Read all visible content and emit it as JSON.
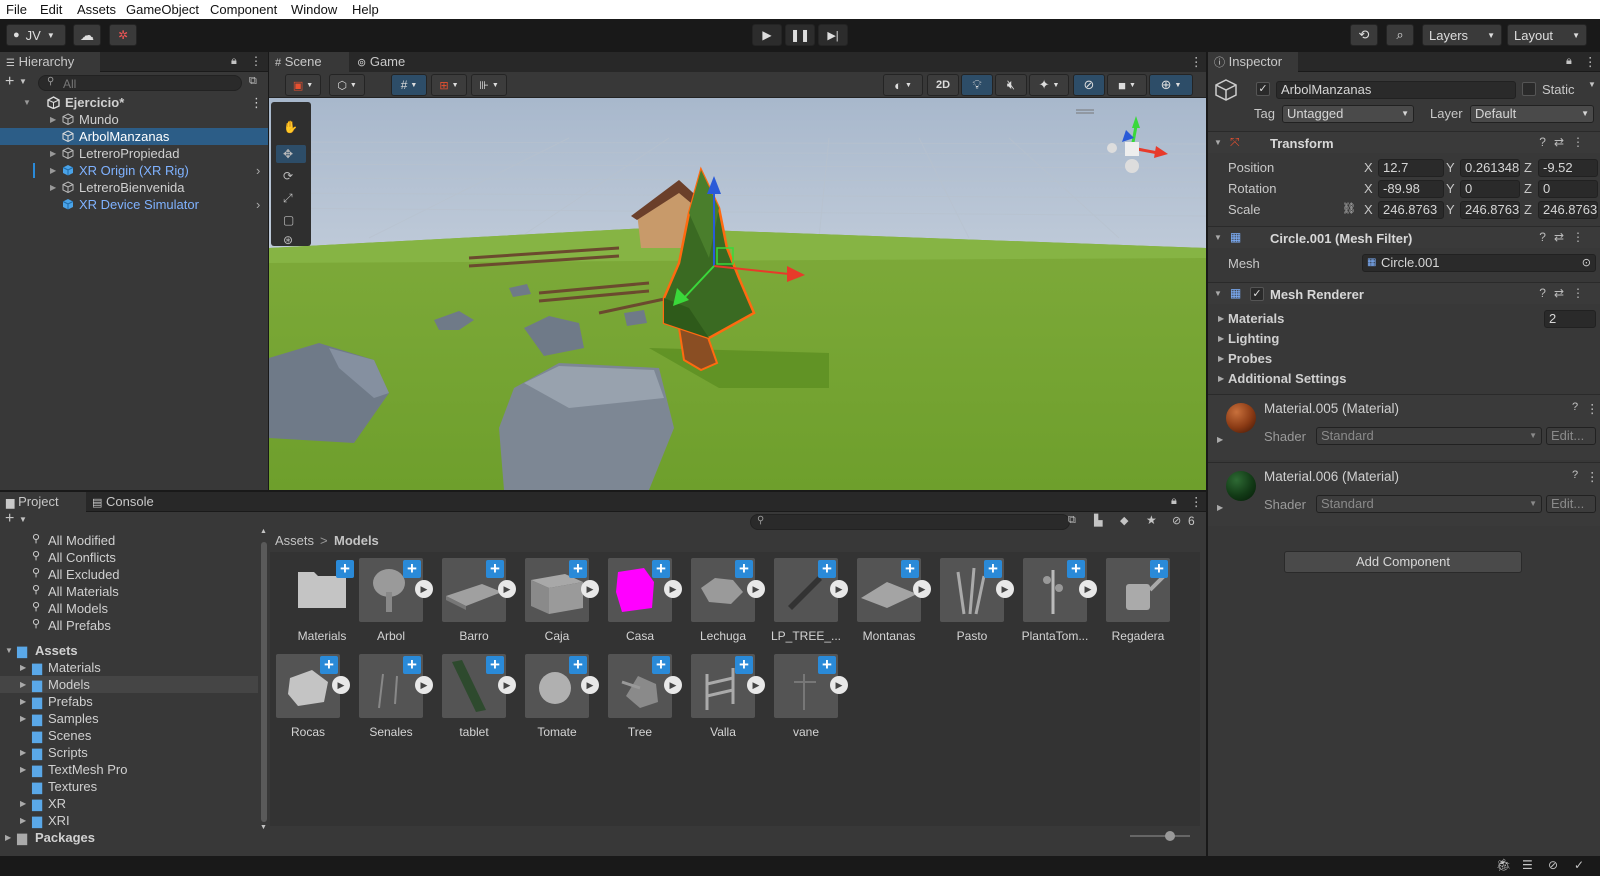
{
  "menubar": {
    "items": [
      "File",
      "Edit",
      "Assets",
      "GameObject",
      "Component",
      "Window",
      "Help"
    ]
  },
  "toolbar": {
    "account": "JV",
    "layers": "Layers",
    "layout": "Layout"
  },
  "hierarchy": {
    "tab": "Hierarchy",
    "search_placeholder": "All",
    "scene": "Ejercicio*",
    "items": [
      "Mundo",
      "ArbolManzanas",
      "LetreroPropiedad",
      "XR Origin (XR Rig)",
      "LetreroBienvenida",
      "XR Device Simulator"
    ]
  },
  "scene_view": {
    "tab_scene": "Scene",
    "tab_game": "Game",
    "mode_2d": "2D"
  },
  "project": {
    "tab_project": "Project",
    "tab_console": "Console",
    "favorites": [
      "All Modified",
      "All Conflicts",
      "All Excluded",
      "All Materials",
      "All Models",
      "All Prefabs"
    ],
    "assets_root": "Assets",
    "folders": [
      "Materials",
      "Models",
      "Prefabs",
      "Samples",
      "Scenes",
      "Scripts",
      "TextMesh Pro",
      "Textures",
      "XR",
      "XRI"
    ],
    "packages": "Packages",
    "breadcrumb_root": "Assets",
    "breadcrumb_sep": ">",
    "breadcrumb_current": "Models",
    "hidden_count": "6",
    "assets_row1": [
      "Materials",
      "Arbol",
      "Barro",
      "Caja",
      "Casa",
      "Lechuga",
      "LP_TREE_...",
      "Montanas",
      "Pasto",
      "PlantaTom...",
      "Regadera"
    ],
    "assets_row2": [
      "Rocas",
      "Senales",
      "tablet",
      "Tomate",
      "Tree",
      "Valla",
      "vane"
    ]
  },
  "inspector": {
    "tab": "Inspector",
    "object_name": "ArbolManzanas",
    "static_label": "Static",
    "tag_label": "Tag",
    "tag_value": "Untagged",
    "layer_label": "Layer",
    "layer_value": "Default",
    "transform": {
      "title": "Transform",
      "position_label": "Position",
      "px": "12.7",
      "py": "0.261348",
      "pz": "-9.52",
      "rotation_label": "Rotation",
      "rx": "-89.98",
      "ry": "0",
      "rz": "0",
      "scale_label": "Scale",
      "sx": "246.8763",
      "sy": "246.8763",
      "sz": "246.8763",
      "x": "X",
      "y": "Y",
      "z": "Z"
    },
    "mesh_filter": {
      "title": "Circle.001 (Mesh Filter)",
      "mesh_label": "Mesh",
      "mesh_value": "Circle.001"
    },
    "mesh_renderer": {
      "title": "Mesh Renderer",
      "materials_label": "Materials",
      "materials_count": "2",
      "lighting": "Lighting",
      "probes": "Probes",
      "additional": "Additional Settings"
    },
    "materials": [
      {
        "name": "Material.005 (Material)",
        "shader_label": "Shader",
        "shader": "Standard",
        "edit": "Edit...",
        "color": "#8a3a14"
      },
      {
        "name": "Material.006 (Material)",
        "shader_label": "Shader",
        "shader": "Standard",
        "edit": "Edit...",
        "color": "#123a16"
      }
    ],
    "add_component": "Add Component"
  },
  "colors": {
    "selection": "#2c5d87",
    "accent_blue": "#2a8ad8",
    "casa_thumb": "#ff00ff",
    "prefab_blue": "#7fb2ff"
  }
}
